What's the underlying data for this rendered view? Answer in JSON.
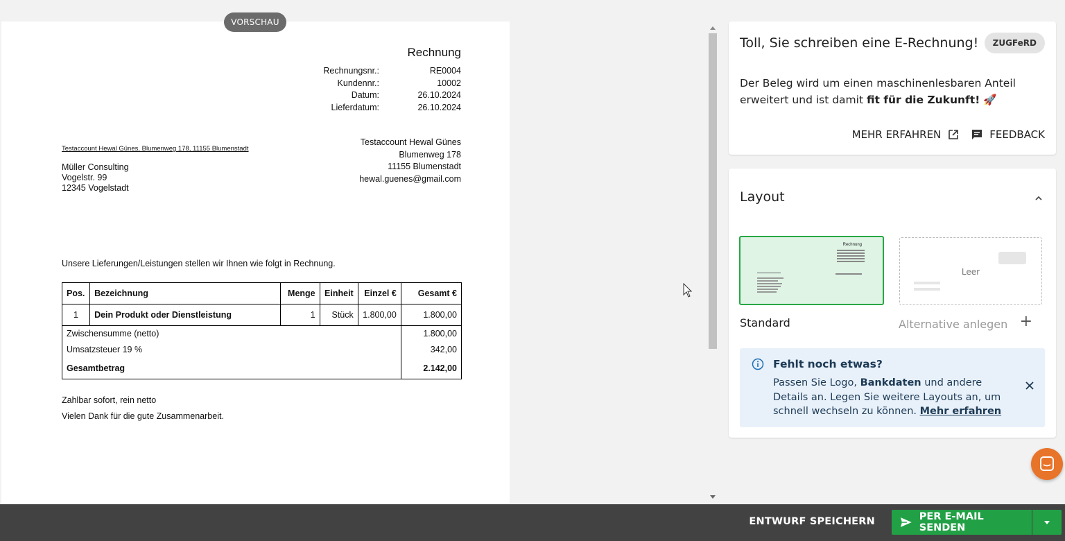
{
  "preview": {
    "badge": "VORSCHAU",
    "invoice": {
      "title": "Rechnung",
      "meta_labels": [
        "Rechnungsnr.:",
        "Kundennr.:",
        "Datum:",
        "Lieferdatum:"
      ],
      "meta_values": [
        "RE0004",
        "10002",
        "26.10.2024",
        "26.10.2024"
      ],
      "sender_line": "Testaccount Hewal Günes, Blumenweg 178, 11155 Blumenstadt",
      "recipient": [
        "Müller Consulting",
        "Vogelstr. 99",
        "12345 Vogelstadt"
      ],
      "issuer": [
        "Testaccount Hewal Günes",
        "Blumenweg 178",
        "11155 Blumenstadt",
        "hewal.guenes@gmail.com"
      ],
      "intro": "Unsere Lieferungen/Leistungen stellen wir Ihnen wie folgt in Rechnung.",
      "columns": [
        "Pos.",
        "Bezeichnung",
        "Menge",
        "Einheit",
        "Einzel €",
        "Gesamt €"
      ],
      "items": [
        {
          "pos": "1",
          "name": "Dein Produkt oder Dienstleistung",
          "qty": "1",
          "unit": "Stück",
          "price": "1.800,00",
          "total": "1.800,00"
        }
      ],
      "subtotal_label": "Zwischensumme (netto)",
      "subtotal_value": "1.800,00",
      "tax_label": "Umsatzsteuer 19 %",
      "tax_value": "342,00",
      "grand_label": "Gesamtbetrag",
      "grand_value": "2.142,00",
      "payment_terms": "Zahlbar sofort, rein netto",
      "closing": "Vielen Dank für die gute Zusammenarbeit."
    }
  },
  "erechnung": {
    "title": "Toll, Sie schreiben eine E-Rechnung!",
    "badge": "ZUGFeRD",
    "body_plain": "Der Beleg wird um einen maschinenlesbaren Anteil erweitert und ist damit ",
    "body_bold": "fit für die Zukunft!",
    "emoji": "🚀",
    "link_more": "MEHR ERFAHREN",
    "link_feedback": "FEEDBACK"
  },
  "layout": {
    "title": "Layout",
    "standard_label": "Standard",
    "thumb_title": "Rechnung",
    "empty_label": "Leer",
    "alt_label": "Alternative anlegen",
    "plus": "+",
    "info": {
      "title": "Fehlt noch etwas?",
      "text_1": "Passen Sie Logo, ",
      "text_bold": "Bankdaten",
      "text_2": " und andere Details an. Legen Sie weitere Layouts an, um schnell wechseln zu können. ",
      "link": "Mehr erfahren"
    }
  },
  "bottombar": {
    "draft": "ENTWURF SPEICHERN",
    "send": "PER E-MAIL SENDEN"
  },
  "colors": {
    "accent_green": "#22a046",
    "bottombar": "#424242",
    "chat_orange": "#e8742a",
    "info_bg": "#e8f1fa"
  }
}
